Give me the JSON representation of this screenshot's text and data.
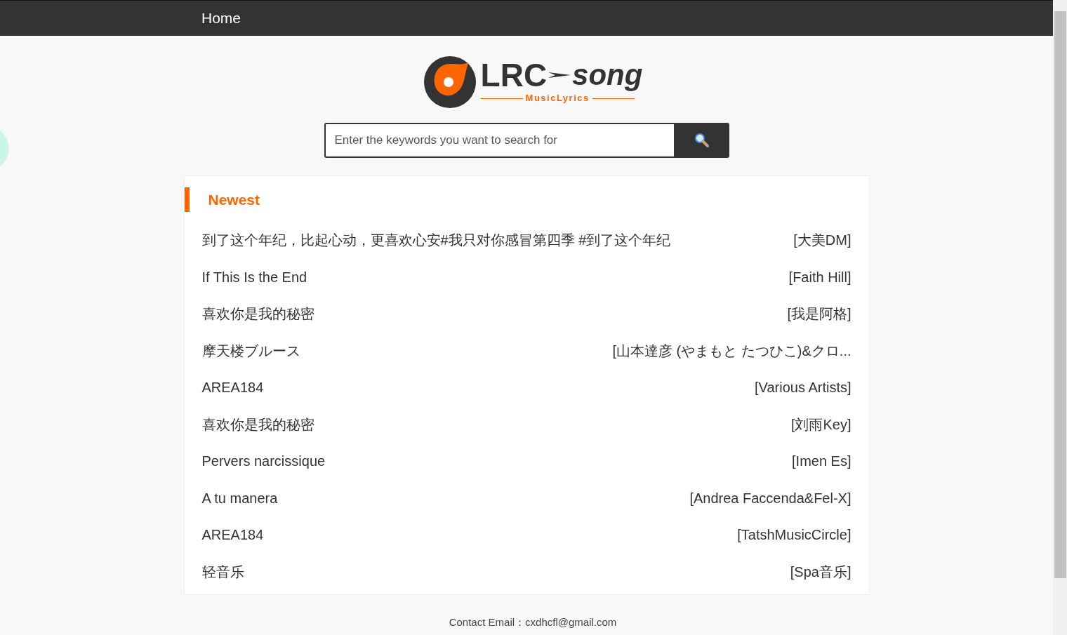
{
  "nav": {
    "home": "Home"
  },
  "logo": {
    "main": "LRC",
    "script": "song",
    "tagline": "MusicLyrics"
  },
  "search": {
    "placeholder": "Enter the keywords you want to search for"
  },
  "newest": {
    "title": "Newest",
    "rows": [
      {
        "song": "到了这个年纪，比起心动，更喜欢心安#我只对你感冒第四季 #到了这个年纪",
        "artist": "[大美DM]"
      },
      {
        "song": "If This Is the End",
        "artist": "[Faith Hill]"
      },
      {
        "song": "喜欢你是我的秘密",
        "artist": "[我是阿格]"
      },
      {
        "song": "摩天楼ブルース",
        "artist": "[山本達彦 (やまもと たつひこ)&クロ..."
      },
      {
        "song": "AREA184",
        "artist": "[Various Artists]"
      },
      {
        "song": "喜欢你是我的秘密",
        "artist": "[刘雨Key]"
      },
      {
        "song": "Pervers narcissique",
        "artist": "[Imen Es]"
      },
      {
        "song": "A tu manera",
        "artist": "[Andrea Faccenda&Fel-X]"
      },
      {
        "song": "AREA184",
        "artist": "[TatshMusicCircle]"
      },
      {
        "song": "轻音乐",
        "artist": "[Spa音乐]"
      }
    ]
  },
  "footer": {
    "contact": "Contact Email：cxdhcfl@gmail.com"
  }
}
